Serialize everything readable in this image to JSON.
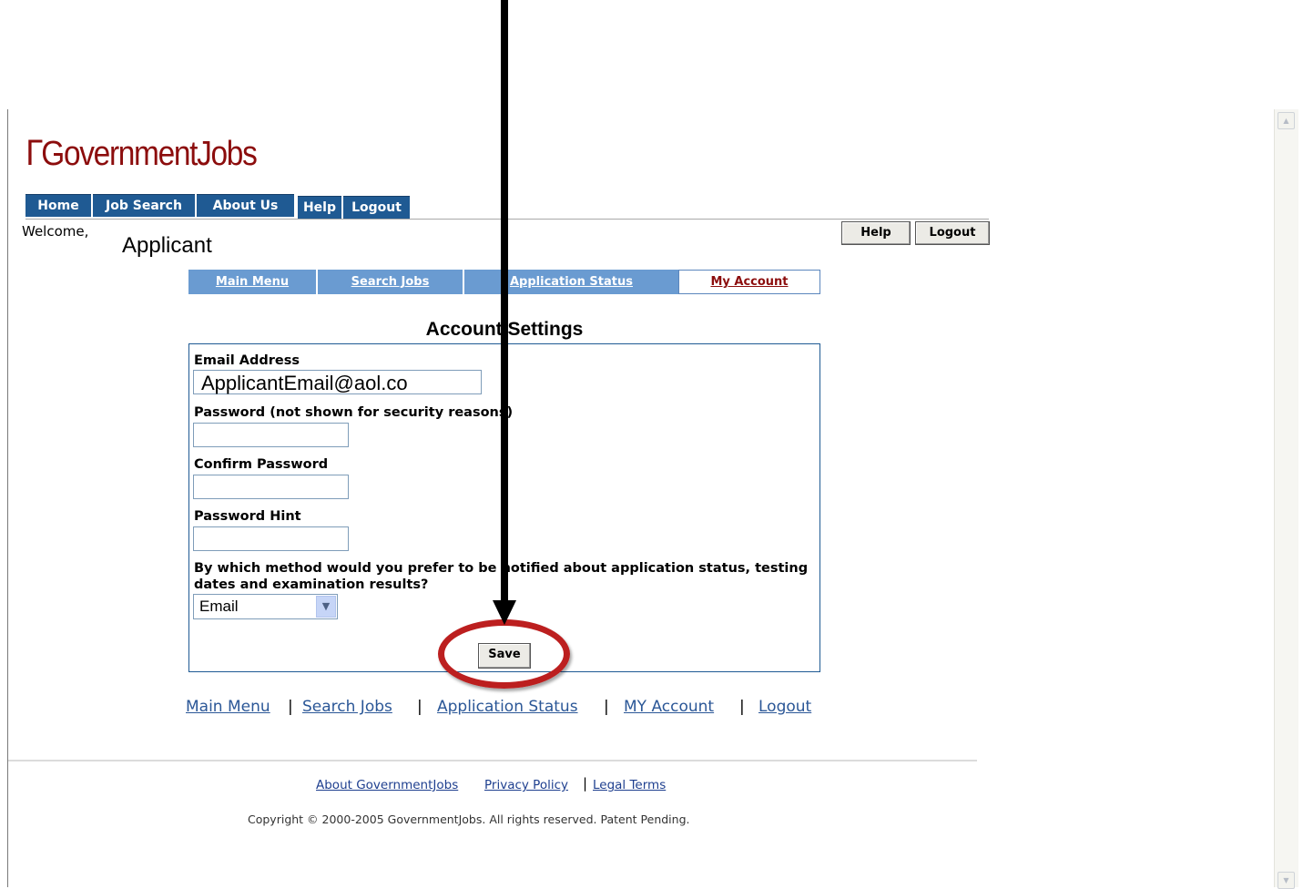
{
  "logo": {
    "text": "GovernmentJobs",
    "color": "#8c0d0d"
  },
  "top_nav": [
    "Home",
    "Job Search",
    "About Us",
    "Help",
    "Logout"
  ],
  "welcome": {
    "label": "Welcome,",
    "name": "Applicant"
  },
  "header_buttons": {
    "help": "Help",
    "logout": "Logout"
  },
  "sub_nav": [
    "Main Menu",
    "Search Jobs",
    "Application Status",
    "My Account"
  ],
  "sub_nav_active": "My Account",
  "form": {
    "title": "Account Settings",
    "email_label": "Email Address",
    "email_value": "ApplicantEmail@aol.co",
    "password_label": "Password (not shown for security reasons)",
    "confirm_label": "Confirm Password",
    "hint_label": "Password Hint",
    "notify_label": "By which method would you prefer to be notified about application status, testing dates and examination results?",
    "notify_value": "Email",
    "save_label": "Save"
  },
  "bottom_nav": [
    "Main Menu",
    "Search Jobs",
    "Application Status",
    "MY Account",
    "Logout"
  ],
  "footer": {
    "about": "About GovernmentJobs",
    "privacy": "Privacy Policy",
    "legal": "Legal Terms",
    "copyright": "Copyright © 2000-2005 GovernmentJobs. All rights reserved. Patent Pending."
  },
  "colors": {
    "nav_bg": "#1f5a93",
    "subnav_bg": "#6a9bd1",
    "active_tab_text": "#8c0d0d",
    "annotation": "#bc1f1f"
  }
}
